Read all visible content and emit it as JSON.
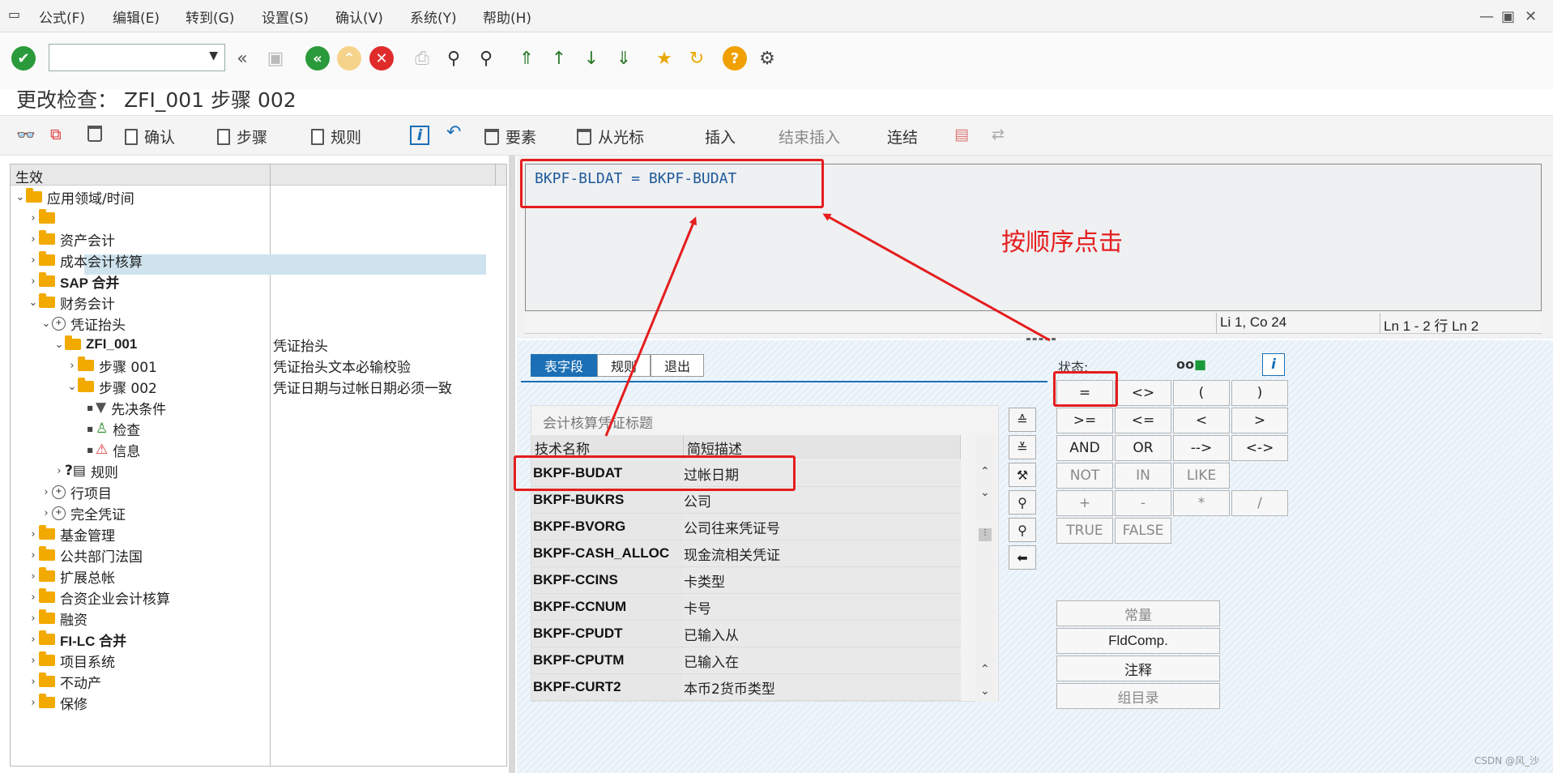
{
  "menu": [
    "公式(F)",
    "编辑(E)",
    "转到(G)",
    "设置(S)",
    "确认(V)",
    "系统(Y)",
    "帮助(H)"
  ],
  "window": {
    "title": "更改检查： ZFI_001 步骤 002"
  },
  "apptoolbar": {
    "confirm": "确认",
    "step": "步骤",
    "rule": "规则",
    "element": "要素",
    "from_cursor": "从光标",
    "insert": "插入",
    "end_insert": "结束插入",
    "link": "连结"
  },
  "tree": {
    "header": "生效",
    "items": [
      {
        "label": "应用领域/时间",
        "desc": ""
      },
      {
        "label": "",
        "desc": ""
      },
      {
        "label": "资产会计",
        "desc": ""
      },
      {
        "label": "成本会计核算",
        "desc": ""
      },
      {
        "label": "SAP 合并",
        "desc": ""
      },
      {
        "label": "财务会计",
        "desc": ""
      },
      {
        "label": "凭证抬头",
        "desc": ""
      },
      {
        "label": "ZFI_001",
        "desc": "凭证抬头"
      },
      {
        "label": "步骤 001",
        "desc": "凭证抬头文本必输校验"
      },
      {
        "label": "步骤 002",
        "desc": "凭证日期与过帐日期必须一致"
      },
      {
        "label": "先决条件",
        "desc": ""
      },
      {
        "label": "检查",
        "desc": ""
      },
      {
        "label": "信息",
        "desc": ""
      },
      {
        "label": "规则",
        "desc": ""
      },
      {
        "label": "行项目",
        "desc": ""
      },
      {
        "label": "完全凭证",
        "desc": ""
      },
      {
        "label": "基金管理",
        "desc": ""
      },
      {
        "label": "公共部门法国",
        "desc": ""
      },
      {
        "label": "扩展总帐",
        "desc": ""
      },
      {
        "label": "合资企业会计核算",
        "desc": ""
      },
      {
        "label": "融资",
        "desc": ""
      },
      {
        "label": "FI-LC 合并",
        "desc": ""
      },
      {
        "label": "项目系统",
        "desc": ""
      },
      {
        "label": "不动产",
        "desc": ""
      },
      {
        "label": "保修",
        "desc": ""
      }
    ]
  },
  "editor": {
    "text": "BKPF-BLDAT = BKPF-BUDAT",
    "status_pos": "Li 1, Co 24",
    "status_lines": "Ln 1 - 2 行 Ln 2"
  },
  "tabs": [
    "表字段",
    "规则",
    "退出"
  ],
  "fields": {
    "title": "会计核算凭证标题",
    "col_name": "技术名称",
    "col_desc": "简短描述",
    "rows": [
      {
        "name": "BKPF-BUDAT",
        "desc": "过帐日期"
      },
      {
        "name": "BKPF-BUKRS",
        "desc": "公司"
      },
      {
        "name": "BKPF-BVORG",
        "desc": "公司往来凭证号"
      },
      {
        "name": "BKPF-CASH_ALLOC",
        "desc": "现金流相关凭证"
      },
      {
        "name": "BKPF-CCINS",
        "desc": "卡类型"
      },
      {
        "name": "BKPF-CCNUM",
        "desc": "卡号"
      },
      {
        "name": "BKPF-CPUDT",
        "desc": "已输入从"
      },
      {
        "name": "BKPF-CPUTM",
        "desc": "已输入在"
      },
      {
        "name": "BKPF-CURT2",
        "desc": "本币2货币类型"
      }
    ]
  },
  "operators": {
    "status_label": "状态:",
    "buttons": [
      "=",
      "<>",
      "(",
      ")",
      ">=",
      "<=",
      "<",
      ">",
      "AND",
      "OR",
      "-->",
      "<->",
      "NOT",
      "IN",
      "LIKE",
      "+",
      "-",
      "*",
      "/",
      "TRUE",
      "FALSE"
    ]
  },
  "bigbuttons": [
    "常量",
    "FldComp.",
    "注释",
    "组目录"
  ],
  "annotation": "按顺序点击",
  "watermark": "CSDN @风_沙",
  "colors": {
    "accent": "#1b6fb5",
    "annotation": "#e51d1d",
    "folder": "#f2a900"
  }
}
